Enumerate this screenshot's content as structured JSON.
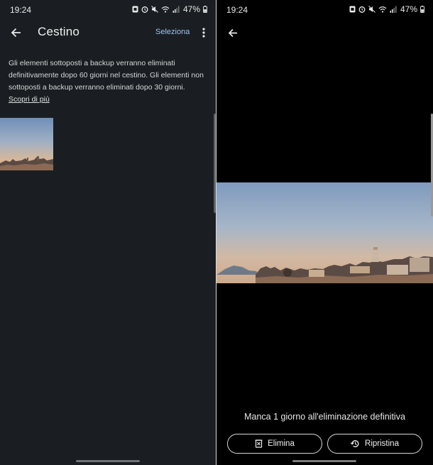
{
  "left": {
    "status": {
      "time": "19:24",
      "battery": "47%"
    },
    "header": {
      "title": "Cestino",
      "select_label": "Seleziona"
    },
    "info_text": "Gli elementi sottoposti a backup verranno eliminati definitivamente dopo 60 giorni nel cestino. Gli elementi non sottoposti a backup verranno eliminati dopo 30 giorni.",
    "learn_more": "Scopri di più"
  },
  "right": {
    "status": {
      "time": "19:24",
      "battery": "47%"
    },
    "days_left_text": "Manca 1 giorno all'eliminazione definitiva",
    "delete_label": "Elimina",
    "restore_label": "Ripristina"
  },
  "icons": {
    "back": "arrow-back-icon",
    "more": "more-vert-icon",
    "delete": "delete-icon",
    "restore": "restore-history-icon"
  },
  "colors": {
    "left_background": "#1a1e22",
    "right_background": "#000000",
    "accent": "#9ec3f0"
  }
}
